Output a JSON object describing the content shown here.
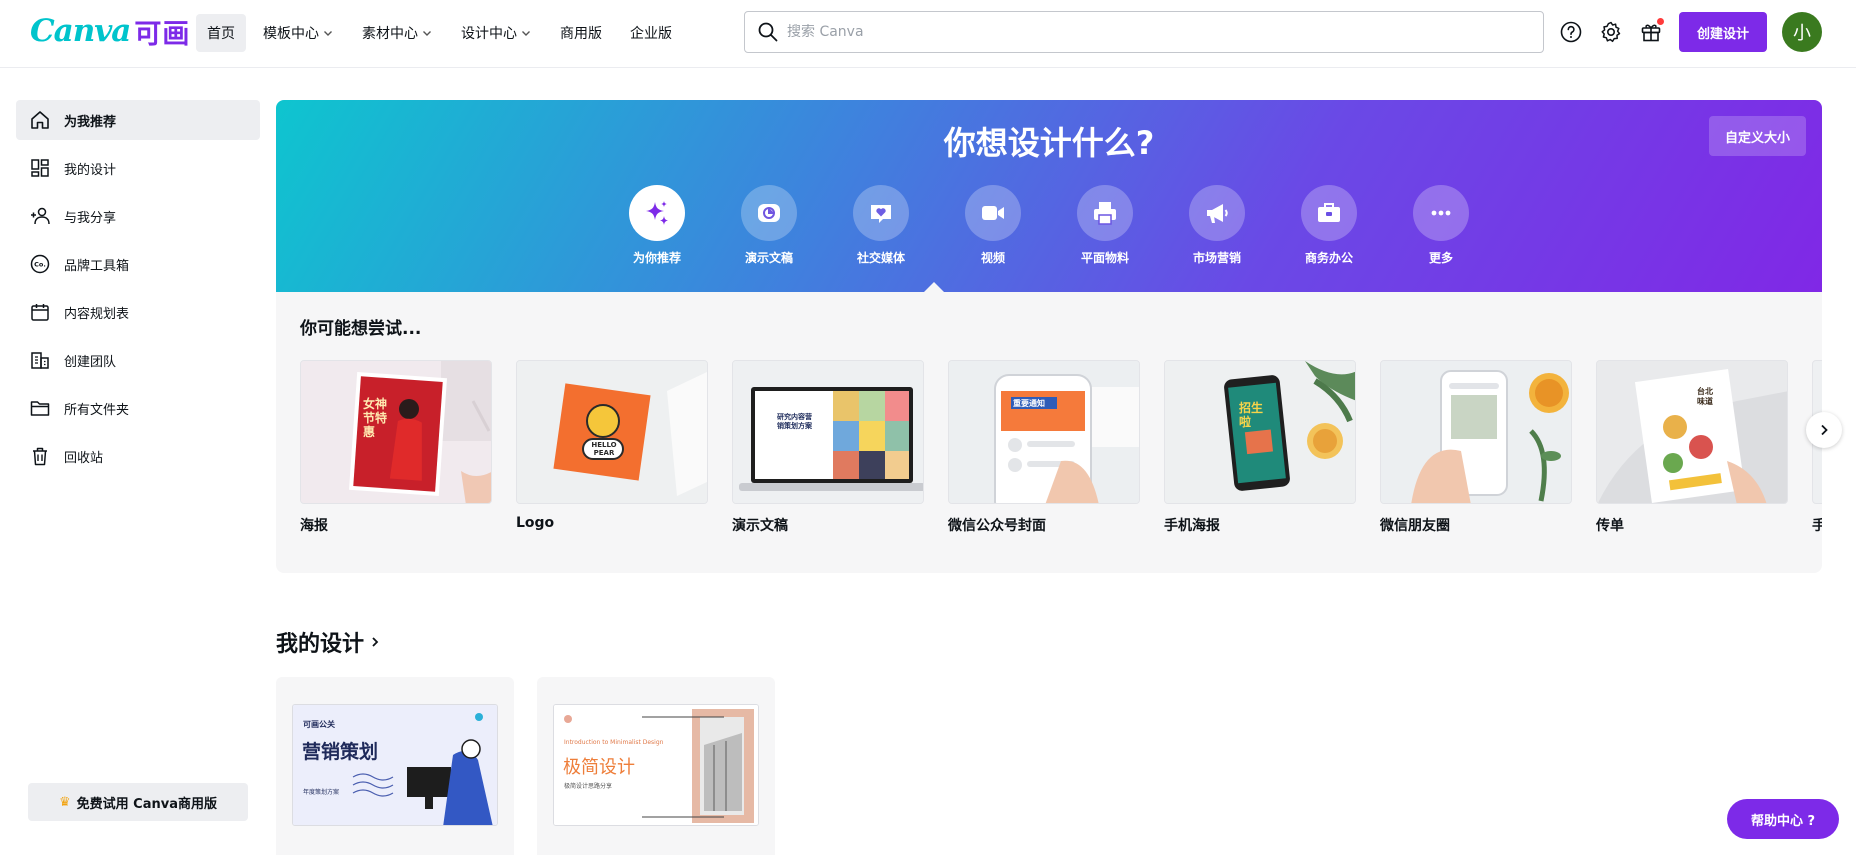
{
  "header": {
    "logo_text": "Canva",
    "logo_cn": "可画",
    "nav": [
      {
        "label": "首页"
      },
      {
        "label": "模板中心"
      },
      {
        "label": "素材中心"
      },
      {
        "label": "设计中心"
      },
      {
        "label": "商用版"
      },
      {
        "label": "企业版"
      }
    ],
    "search_placeholder": "搜索 Canva",
    "create_button": "创建设计",
    "avatar_initial": "小"
  },
  "sidebar": {
    "items": [
      {
        "label": "为我推荐",
        "icon": "home-icon"
      },
      {
        "label": "我的设计",
        "icon": "grid-icon"
      },
      {
        "label": "与我分享",
        "icon": "users-icon"
      },
      {
        "label": "品牌工具箱",
        "icon": "brand-icon"
      },
      {
        "label": "内容规划表",
        "icon": "calendar-icon"
      },
      {
        "label": "创建团队",
        "icon": "team-icon"
      },
      {
        "label": "所有文件夹",
        "icon": "folder-icon"
      },
      {
        "label": "回收站",
        "icon": "trash-icon"
      }
    ],
    "trial_button": "免费试用 Canva商用版"
  },
  "hero": {
    "title": "你想设计什么?",
    "custom_size_button": "自定义大小",
    "categories": [
      {
        "label": "为你推荐",
        "icon": "sparkle-icon"
      },
      {
        "label": "演示文稿",
        "icon": "presentation-icon"
      },
      {
        "label": "社交媒体",
        "icon": "heart-icon"
      },
      {
        "label": "视频",
        "icon": "video-icon"
      },
      {
        "label": "平面物料",
        "icon": "printer-icon"
      },
      {
        "label": "市场营销",
        "icon": "megaphone-icon"
      },
      {
        "label": "商务办公",
        "icon": "briefcase-icon"
      },
      {
        "label": "更多",
        "icon": "more-icon"
      }
    ]
  },
  "suggestions": {
    "title": "你可能想尝试...",
    "cards": [
      {
        "label": "海报",
        "thumb_text": "女神节特惠"
      },
      {
        "label": "Logo",
        "thumb_text": "HELLO PEAR"
      },
      {
        "label": "演示文稿",
        "thumb_text": "研究内容营销策划方案"
      },
      {
        "label": "微信公众号封面",
        "thumb_text": "重要通知"
      },
      {
        "label": "手机海报",
        "thumb_text": "招生啦"
      },
      {
        "label": "微信朋友圈",
        "thumb_text": ""
      },
      {
        "label": "传单",
        "thumb_text": "台北味道"
      },
      {
        "label": "手",
        "thumb_text": ""
      }
    ]
  },
  "my_designs": {
    "title": "我的设计",
    "items": [
      {
        "top_text": "可画公关",
        "title": "营销策划",
        "subtitle": "年度策划方案"
      },
      {
        "top_text": "Introduction to Minimalist Design",
        "title": "极简设计",
        "subtitle": "极简设计思路分享"
      }
    ]
  },
  "help_button": "帮助中心 ?",
  "colors": {
    "brand_purple": "#7d2ae8",
    "brand_cyan": "#00c4cc",
    "avatar_green": "#3a7a1f"
  }
}
